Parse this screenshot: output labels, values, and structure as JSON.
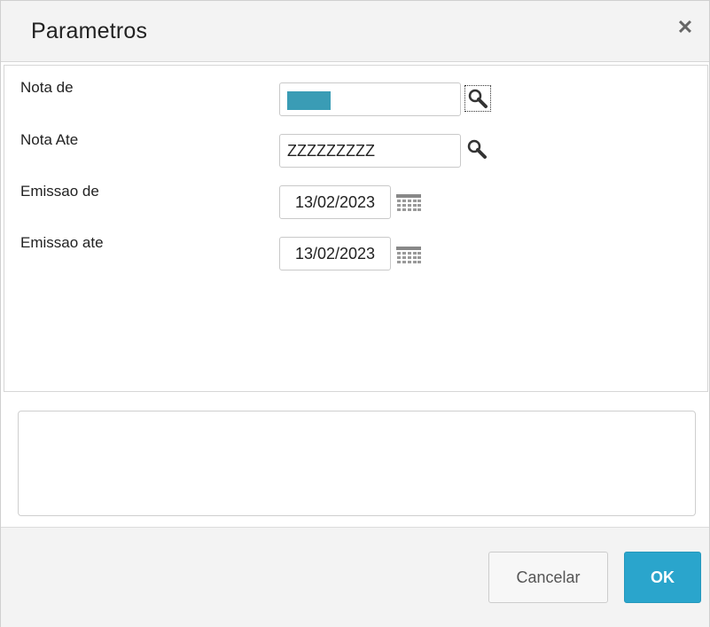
{
  "dialog": {
    "title": "Parametros",
    "close_icon": "close-icon"
  },
  "fields": {
    "nota_de": {
      "label": "Nota de",
      "value": "",
      "icon": "search-icon"
    },
    "nota_ate": {
      "label": "Nota Ate",
      "value": "ZZZZZZZZZ",
      "icon": "search-icon"
    },
    "emissao_de": {
      "label": "Emissao de",
      "value": "13/02/2023",
      "icon": "calendar-icon"
    },
    "emissao_ate": {
      "label": "Emissao ate",
      "value": "13/02/2023",
      "icon": "calendar-icon"
    }
  },
  "footer": {
    "cancel_label": "Cancelar",
    "ok_label": "OK"
  },
  "colors": {
    "accent": "#2aa5cc",
    "selection": "#3a9cb5",
    "header_bg": "#f3f3f3"
  }
}
